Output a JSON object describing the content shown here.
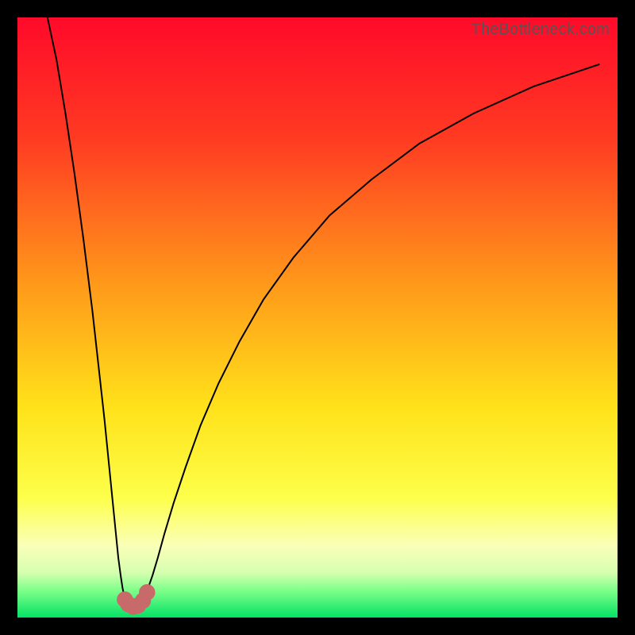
{
  "watermark": "TheBottleneck.com",
  "colors": {
    "frame": "#000000",
    "gradient_stops": [
      {
        "pct": 0,
        "color": "#ff0a2a"
      },
      {
        "pct": 20,
        "color": "#ff3a22"
      },
      {
        "pct": 45,
        "color": "#ff9b1a"
      },
      {
        "pct": 65,
        "color": "#ffe21a"
      },
      {
        "pct": 80,
        "color": "#fdff4a"
      },
      {
        "pct": 88,
        "color": "#faffb8"
      },
      {
        "pct": 92.5,
        "color": "#d6ffb0"
      },
      {
        "pct": 95.5,
        "color": "#7dff8a"
      },
      {
        "pct": 100,
        "color": "#04e265"
      }
    ],
    "curve": "#000000",
    "marker_fill": "#c86a6a",
    "marker_stroke": "#c86a6a"
  },
  "chart_data": {
    "type": "line",
    "title": "",
    "xlabel": "",
    "ylabel": "",
    "xlim": [
      0,
      100
    ],
    "ylim": [
      0,
      100
    ],
    "note": "No axes or tick labels are rendered. Values are estimated from pixel positions on a 0–100 normalized scale in each direction (origin at bottom-left of the colored plot area).",
    "series": [
      {
        "name": "left-branch",
        "x": [
          5.0,
          6.5,
          8.0,
          9.5,
          11.0,
          12.5,
          13.5,
          14.5,
          15.3,
          15.9,
          16.4,
          16.8,
          17.2,
          17.5,
          17.8,
          18.4
        ],
        "y": [
          100,
          93,
          84,
          74,
          63,
          51,
          42,
          33,
          25,
          19,
          14,
          10,
          7,
          5,
          3.5,
          2.5
        ]
      },
      {
        "name": "valley",
        "x": [
          18.4,
          18.8,
          19.2,
          19.6,
          20.0,
          20.6,
          21.2,
          21.8
        ],
        "y": [
          2.5,
          2.0,
          1.8,
          1.8,
          2.0,
          2.5,
          3.5,
          5.0
        ]
      },
      {
        "name": "right-branch",
        "x": [
          21.8,
          22.5,
          23.4,
          24.5,
          26.0,
          28.0,
          30.5,
          33.5,
          37.0,
          41.0,
          46.0,
          52.0,
          59.0,
          67.0,
          76.0,
          86.0,
          97.0
        ],
        "y": [
          5.0,
          7.0,
          10.0,
          14.0,
          19.0,
          25.0,
          32.0,
          39.0,
          46.0,
          53.0,
          60.0,
          67.0,
          73.0,
          79.0,
          84.0,
          88.5,
          92.2
        ]
      }
    ],
    "markers": [
      {
        "x": 17.9,
        "y": 3.0
      },
      {
        "x": 18.5,
        "y": 2.2
      },
      {
        "x": 19.3,
        "y": 1.8
      },
      {
        "x": 20.1,
        "y": 2.0
      },
      {
        "x": 20.9,
        "y": 2.8
      },
      {
        "x": 21.6,
        "y": 4.2
      }
    ]
  }
}
